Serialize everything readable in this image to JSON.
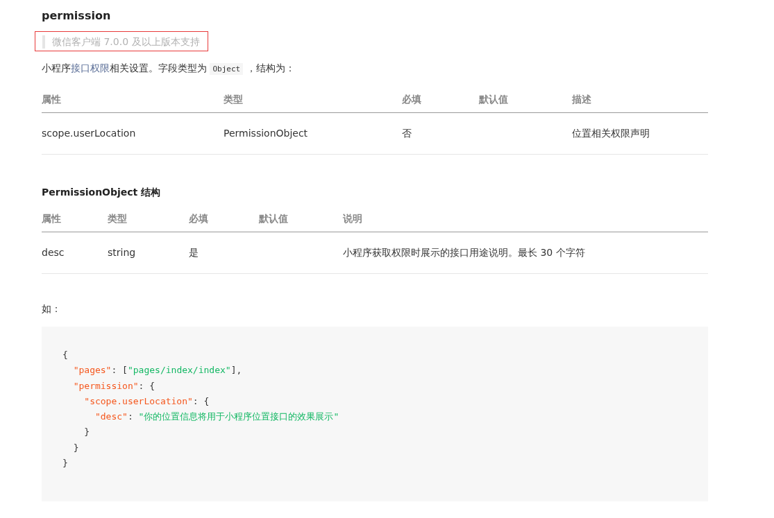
{
  "title": "permission",
  "notice": {
    "text": "微信客户端 7.0.0 及以上版本支持",
    "highlighted": true
  },
  "intro": {
    "before": "小程序",
    "link": "接口权限",
    "middle": "相关设置。字段类型为",
    "code": "Object",
    "after": "，结构为："
  },
  "tables": [
    {
      "columns": [
        "属性",
        "类型",
        "必填",
        "默认值",
        "描述"
      ],
      "rows": [
        [
          "scope.userLocation",
          "PermissionObject",
          "否",
          "",
          "位置相关权限声明"
        ]
      ]
    },
    {
      "heading": "PermissionObject 结构",
      "columns": [
        "属性",
        "类型",
        "必填",
        "默认值",
        "说明"
      ],
      "rows": [
        [
          "desc",
          "string",
          "是",
          "",
          "小程序获取权限时展示的接口用途说明。最长 30 个字符"
        ]
      ]
    }
  ],
  "example_label": "如：",
  "code_lines": [
    [
      {
        "kind": "punct",
        "text": "{"
      }
    ],
    [
      {
        "kind": "key",
        "text": "  \"pages\""
      },
      {
        "kind": "punct",
        "text": ": ["
      },
      {
        "kind": "string",
        "text": "\"pages/index/index\""
      },
      {
        "kind": "punct",
        "text": "],"
      }
    ],
    [
      {
        "kind": "key",
        "text": "  \"permission\""
      },
      {
        "kind": "punct",
        "text": ": {"
      }
    ],
    [
      {
        "kind": "key",
        "text": "    \"scope.userLocation\""
      },
      {
        "kind": "punct",
        "text": ": {"
      }
    ],
    [
      {
        "kind": "key",
        "text": "      \"desc\""
      },
      {
        "kind": "punct",
        "text": ": "
      },
      {
        "kind": "string",
        "text": "\"你的位置信息将用于小程序位置接口的效果展示\""
      }
    ],
    [
      {
        "kind": "punct",
        "text": "    }"
      }
    ],
    [
      {
        "kind": "punct",
        "text": "  }"
      }
    ],
    [
      {
        "kind": "punct",
        "text": "}"
      }
    ]
  ]
}
